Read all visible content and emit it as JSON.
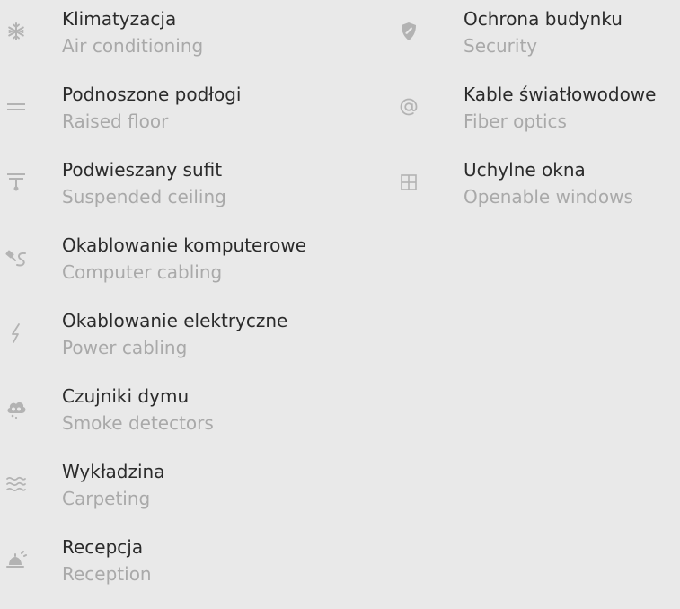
{
  "left_column": [
    {
      "icon": "snowflake-icon",
      "label": "Klimatyzacja",
      "sublabel": "Air conditioning"
    },
    {
      "icon": "raised-floor-icon",
      "label": "Podnoszone podłogi",
      "sublabel": "Raised floor"
    },
    {
      "icon": "suspended-ceiling-icon",
      "label": "Podwieszany sufit",
      "sublabel": "Suspended ceiling"
    },
    {
      "icon": "network-cable-icon",
      "label": "Okablowanie komputerowe",
      "sublabel": "Computer cabling"
    },
    {
      "icon": "lightning-icon",
      "label": "Okablowanie elektryczne",
      "sublabel": "Power cabling"
    },
    {
      "icon": "smoke-detector-icon",
      "label": "Czujniki dymu",
      "sublabel": "Smoke detectors"
    },
    {
      "icon": "carpet-waves-icon",
      "label": "Wykładzina",
      "sublabel": "Carpeting"
    },
    {
      "icon": "reception-bell-icon",
      "label": "Recepcja",
      "sublabel": "Reception"
    }
  ],
  "right_column": [
    {
      "icon": "shield-icon",
      "label": "Ochrona budynku",
      "sublabel": "Security"
    },
    {
      "icon": "at-sign-icon",
      "label": "Kable światłowodowe",
      "sublabel": "Fiber optics"
    },
    {
      "icon": "window-icon",
      "label": "Uchylne okna",
      "sublabel": "Openable windows"
    }
  ],
  "colors": {
    "background": "#e9e9e9",
    "label": "#2b2b2b",
    "sublabel": "#a9a9a9",
    "icon": "#b3b3b3"
  }
}
